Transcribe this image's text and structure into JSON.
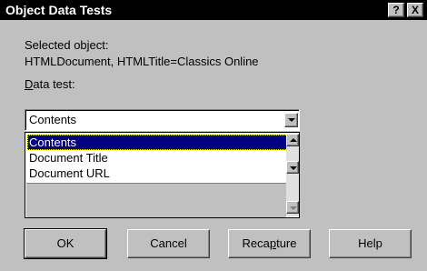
{
  "window": {
    "title": "Object Data Tests",
    "help_button": "?",
    "close_button": "X"
  },
  "selected_object": {
    "label": "Selected object:",
    "value": "HTMLDocument, HTMLTitle=Classics Online"
  },
  "data_test": {
    "label_prefix": "",
    "label_hotkey": "D",
    "label_rest": "ata test:",
    "selected_value": "Contents",
    "options": [
      "Contents",
      "Document Title",
      "Document URL"
    ]
  },
  "buttons": {
    "ok": "OK",
    "cancel": "Cancel",
    "recapture_prefix": "Reca",
    "recapture_hotkey": "p",
    "recapture_rest": "ture",
    "help": "Help"
  }
}
